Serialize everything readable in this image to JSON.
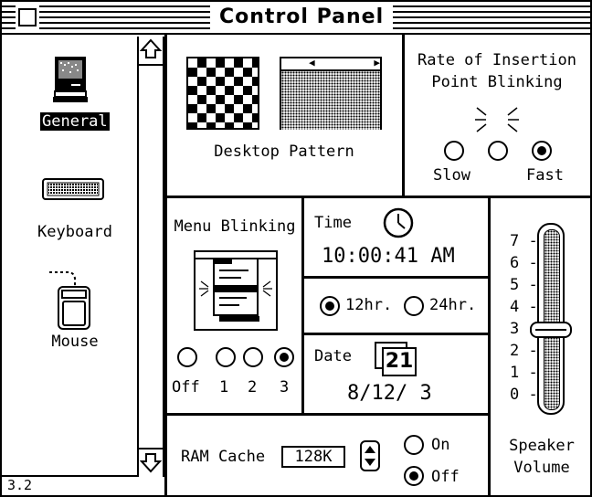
{
  "window": {
    "title": "Control Panel",
    "version": "3.2"
  },
  "sidebar": {
    "items": [
      {
        "label": "General",
        "selected": true,
        "icon": "mac-computer-icon"
      },
      {
        "label": "Keyboard",
        "selected": false,
        "icon": "keyboard-icon"
      },
      {
        "label": "Mouse",
        "selected": false,
        "icon": "mouse-icon"
      }
    ]
  },
  "desktop": {
    "label": "Desktop Pattern"
  },
  "blink_rate": {
    "title_line1": "Rate of Insertion",
    "title_line2": "Point Blinking",
    "slow_label": "Slow",
    "fast_label": "Fast",
    "selected": 3
  },
  "menu_blinking": {
    "title": "Menu Blinking",
    "options": [
      "Off",
      "1",
      "2",
      "3"
    ],
    "selected": "3"
  },
  "time": {
    "label": "Time",
    "value": "10:00:41 AM",
    "h12_label": "12hr.",
    "h24_label": "24hr.",
    "format": "12hr."
  },
  "date": {
    "label": "Date",
    "value": "8/12/ 3",
    "calendar_day": "21"
  },
  "speaker": {
    "ticks": [
      "7",
      "6",
      "5",
      "4",
      "3",
      "2",
      "1",
      "0"
    ],
    "level": 3,
    "label_line1": "Speaker",
    "label_line2": "Volume"
  },
  "ram_cache": {
    "label": "RAM Cache",
    "value": "128K",
    "on_label": "On",
    "off_label": "Off",
    "state": "Off"
  }
}
